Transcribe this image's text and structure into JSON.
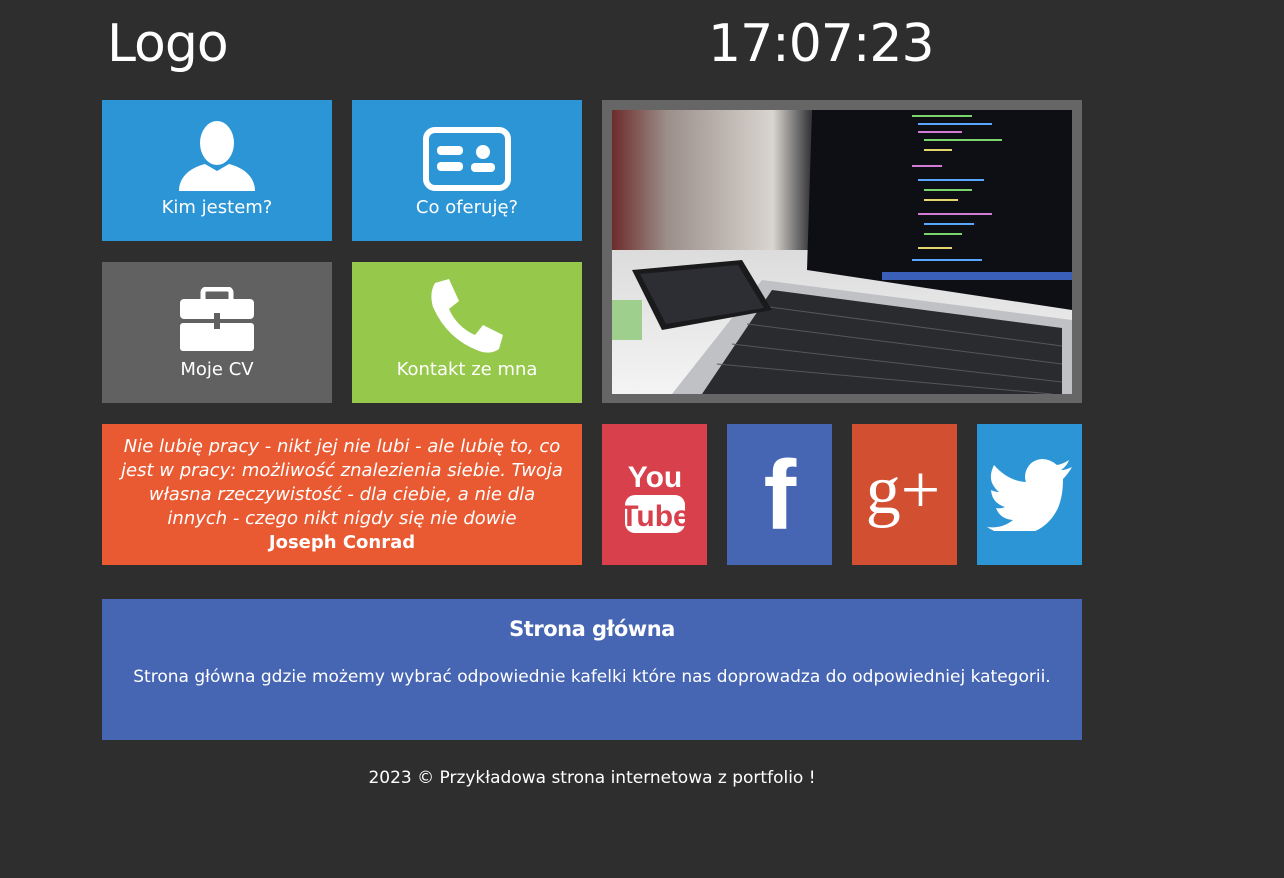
{
  "header": {
    "logo": "Logo",
    "clock": "17:07:23"
  },
  "tiles": [
    {
      "label": "Kim jestem?",
      "icon": "user-icon",
      "color": "#2b95d6"
    },
    {
      "label": "Co oferuję?",
      "icon": "id-card-icon",
      "color": "#2b95d6"
    },
    {
      "label": "Moje CV",
      "icon": "briefcase-icon",
      "color": "#616161"
    },
    {
      "label": "Kontakt ze mna",
      "icon": "phone-icon",
      "color": "#96c84b"
    }
  ],
  "photo": {
    "icon": "laptop-photo",
    "frame_color": "#666666"
  },
  "quote": {
    "text": "Nie lubię pracy - nikt jej nie lubi - ale lubię to, co jest w pracy: możliwość znalezienia siebie. Twoja własna rzeczywistość - dla ciebie, a nie dla innych - czego nikt nigdy się nie dowie",
    "author": "Joseph Conrad",
    "color": "#ea5a32"
  },
  "social": [
    {
      "name": "youtube",
      "icon": "youtube-icon",
      "label_top": "You",
      "label_bottom": "Tube",
      "color": "#d8404c"
    },
    {
      "name": "facebook",
      "icon": "facebook-icon",
      "glyph": "f",
      "color": "#4665b2"
    },
    {
      "name": "google-plus",
      "icon": "google-plus-icon",
      "glyph": "g+",
      "color": "#d34f31"
    },
    {
      "name": "twitter",
      "icon": "twitter-icon",
      "color": "#2b95d6"
    }
  ],
  "info": {
    "title": "Strona główna",
    "text": "Strona główna gdzie możemy wybrać odpowiednie kafelki które nas doprowadza do odpowiedniej kategorii.",
    "color": "#4665b2"
  },
  "footer": {
    "text": "2023 © Przykładowa strona internetowa z portfolio !"
  }
}
